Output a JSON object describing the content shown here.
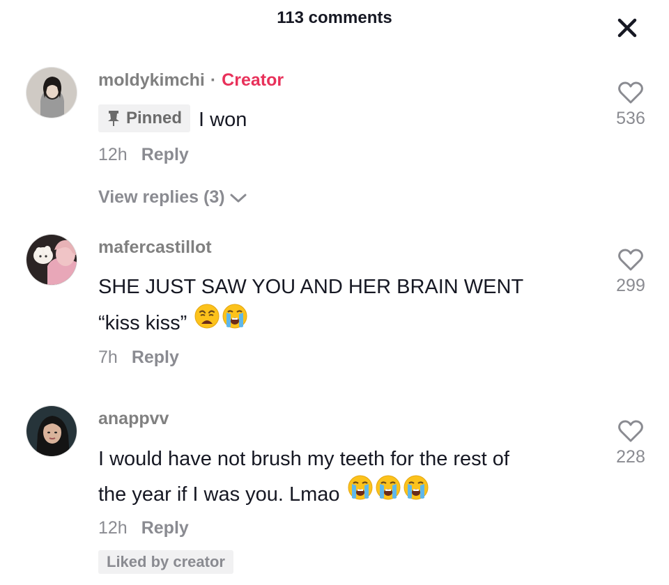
{
  "header": {
    "title": "113 comments",
    "close_icon": "close-icon"
  },
  "comments": [
    {
      "username": "moldykimchi",
      "separator": "·",
      "creator_label": "Creator",
      "pinned_label": "Pinned",
      "text": "I won",
      "time": "12h",
      "reply_label": "Reply",
      "view_replies": "View replies (3)",
      "likes": "536"
    },
    {
      "username": "mafercastillot",
      "text_line1": "SHE JUST SAW YOU AND HER BRAIN WENT",
      "text_line2": "“kiss kiss”",
      "emojis": [
        "weary-face-emoji",
        "loudly-crying-face-emoji"
      ],
      "time": "7h",
      "reply_label": "Reply",
      "likes": "299"
    },
    {
      "username": "anappvv",
      "text_line1": "I would have not brush my teeth for the rest of",
      "text_line2": "the year if I was you. Lmao",
      "emojis": [
        "loudly-crying-face-emoji",
        "loudly-crying-face-emoji",
        "loudly-crying-face-emoji"
      ],
      "time": "12h",
      "reply_label": "Reply",
      "liked_by_creator": "Liked by creator",
      "likes": "228"
    }
  ],
  "colors": {
    "creator_accent": "#e8315a",
    "muted_text": "#8a8b91",
    "badge_bg": "#f1f1f2"
  }
}
